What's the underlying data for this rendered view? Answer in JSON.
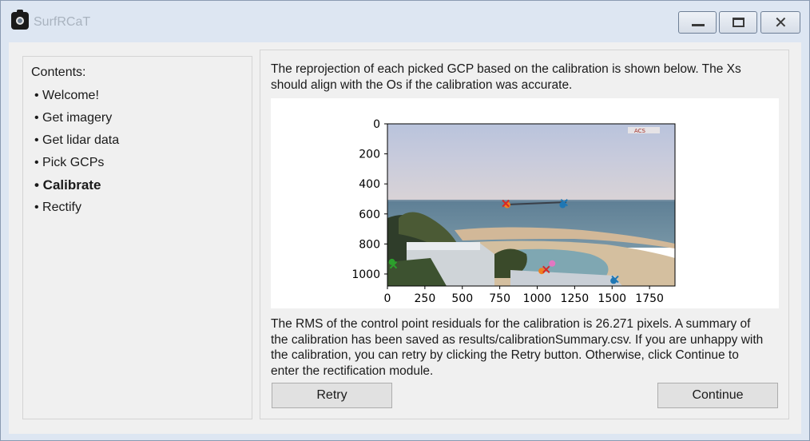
{
  "window": {
    "title": "SurfRCaT",
    "controls": {
      "minimize": "minimize-icon",
      "maximize": "maximize-icon",
      "close": "close-icon"
    }
  },
  "sidebar": {
    "title": "Contents:",
    "items": [
      {
        "label": "• Welcome!",
        "active": false
      },
      {
        "label": "• Get imagery",
        "active": false
      },
      {
        "label": "• Get lidar data",
        "active": false
      },
      {
        "label": "• Pick GCPs",
        "active": false
      },
      {
        "label": "• Calibrate",
        "active": true
      },
      {
        "label": "• Rectify",
        "active": false
      }
    ]
  },
  "main": {
    "intro_line1": "The reprojection of each picked GCP based on the calibration is shown below. The Xs",
    "intro_line2": "should align with the Os if the calibration was accurate.",
    "summary_line1": "The RMS of the control point residuals for the calibration is 26.271 pixels. A summary of",
    "summary_line2": "the calibration has been saved as results/calibrationSummary.csv. If you are unhappy with",
    "summary_line3": "the calibration, you can retry by clicking the Retry button. Otherwise, click Continue to",
    "summary_line4": "enter the rectification module.",
    "retry_label": "Retry",
    "continue_label": "Continue"
  },
  "chart_data": {
    "type": "image",
    "x_ticks": [
      "0",
      "250",
      "500",
      "750",
      "1000",
      "1250",
      "1500",
      "1750"
    ],
    "y_ticks": [
      "0",
      "200",
      "400",
      "600",
      "800",
      "1000"
    ],
    "xlim": [
      0,
      1920
    ],
    "ylim": [
      1080,
      0
    ],
    "y_inverted": true,
    "markers": [
      {
        "shape": "o",
        "x": 800,
        "y": 540,
        "color": "#f07f20"
      },
      {
        "shape": "x",
        "x": 790,
        "y": 530,
        "color": "#d62728"
      },
      {
        "shape": "o",
        "x": 1170,
        "y": 540,
        "color": "#1f77b4"
      },
      {
        "shape": "x",
        "x": 1180,
        "y": 525,
        "color": "#1f77b4"
      },
      {
        "shape": "o",
        "x": 30,
        "y": 920,
        "color": "#2ca02c"
      },
      {
        "shape": "x",
        "x": 40,
        "y": 940,
        "color": "#2ca02c"
      },
      {
        "shape": "o",
        "x": 1030,
        "y": 980,
        "color": "#f07f20"
      },
      {
        "shape": "x",
        "x": 1060,
        "y": 970,
        "color": "#d62728"
      },
      {
        "shape": "o",
        "x": 1100,
        "y": 930,
        "color": "#e377c2"
      },
      {
        "shape": "o",
        "x": 1510,
        "y": 1045,
        "color": "#1f77b4"
      },
      {
        "shape": "x",
        "x": 1520,
        "y": 1035,
        "color": "#1f77b4"
      }
    ]
  }
}
